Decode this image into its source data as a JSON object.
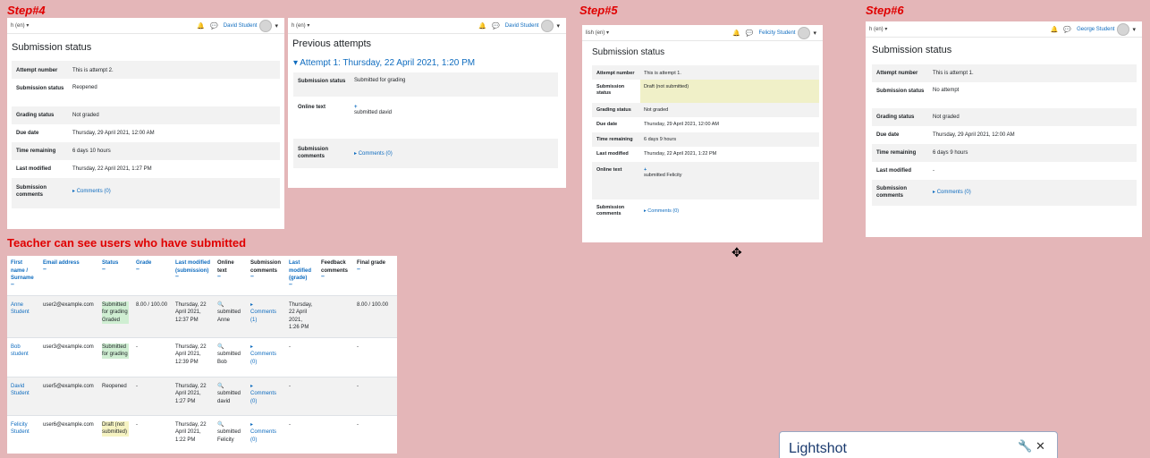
{
  "steps": {
    "s4": "Step#4",
    "s5": "Step#5",
    "s6": "Step#6"
  },
  "teacher_note": "Teacher can see users who have submitted",
  "panelA": {
    "lang": "h (en) ▾",
    "user": "David Student",
    "title": "Submission status",
    "rows": [
      {
        "k": "Attempt number",
        "v": "This is attempt 2."
      },
      {
        "k": "Submission status",
        "v": "Reopened"
      },
      {
        "k": "Grading status",
        "v": "Not graded"
      },
      {
        "k": "Due date",
        "v": "Thursday, 29 April 2021, 12:00 AM"
      },
      {
        "k": "Time remaining",
        "v": "6 days 10 hours"
      },
      {
        "k": "Last modified",
        "v": "Thursday, 22 April 2021, 1:27 PM"
      },
      {
        "k": "Submission comments",
        "v": "Comments (0)"
      }
    ]
  },
  "panelB": {
    "lang": "h (en) ▾",
    "user": "David Student",
    "title": "Previous attempts",
    "attempt": "Attempt 1: Thursday, 22 April 2021, 1:20 PM",
    "rows": [
      {
        "k": "Submission status",
        "v": "Submitted for grading"
      },
      {
        "k": "Online text",
        "v": "submitted david"
      },
      {
        "k": "Submission comments",
        "v": "Comments (0)"
      }
    ]
  },
  "panelC": {
    "lang": "lish (en) ▾",
    "user": "Felicity Student",
    "title": "Submission status",
    "rows": [
      {
        "k": "Attempt number",
        "v": "This is attempt 1."
      },
      {
        "k": "Submission status",
        "v": "Draft (not submitted)"
      },
      {
        "k": "Grading status",
        "v": "Not graded"
      },
      {
        "k": "Due date",
        "v": "Thursday, 29 April 2021, 12:00 AM"
      },
      {
        "k": "Time remaining",
        "v": "6 days 9 hours"
      },
      {
        "k": "Last modified",
        "v": "Thursday, 22 April 2021, 1:22 PM"
      },
      {
        "k": "Online text",
        "v": "submitted Felicity"
      },
      {
        "k": "Submission comments",
        "v": "Comments (0)"
      }
    ]
  },
  "panelD": {
    "lang": "h (en) ▾",
    "user": "George Student",
    "title": "Submission status",
    "rows": [
      {
        "k": "Attempt number",
        "v": "This is attempt 1."
      },
      {
        "k": "Submission status",
        "v": "No attempt"
      },
      {
        "k": "Grading status",
        "v": "Not graded"
      },
      {
        "k": "Due date",
        "v": "Thursday, 29 April 2021, 12:00 AM"
      },
      {
        "k": "Time remaining",
        "v": "6 days 9 hours"
      },
      {
        "k": "Last modified",
        "v": "-"
      },
      {
        "k": "Submission comments",
        "v": "Comments (0)"
      }
    ]
  },
  "grading": {
    "headers": [
      "First name / Surname",
      "Email address",
      "Status",
      "Grade",
      "Last modified (submission)",
      "Online text",
      "Submission comments",
      "Last modified (grade)",
      "Feedback comments",
      "Final grade"
    ],
    "rows": [
      {
        "name": "Anne Student",
        "email": "user2@example.com",
        "status": "Submitted for grading Graded",
        "grade": "8.00 / 100.00",
        "modified": "Thursday, 22 April 2021, 12:37 PM",
        "online": "submitted Anne",
        "comments": "Comments (1)",
        "gradeMod": "Thursday, 22 April 2021, 1:26 PM",
        "feedback": "",
        "final": "8.00 / 100.00"
      },
      {
        "name": "Bob student",
        "email": "user3@example.com",
        "status": "Submitted for grading",
        "grade": "-",
        "modified": "Thursday, 22 April 2021, 12:39 PM",
        "online": "submitted Bob",
        "comments": "Comments (0)",
        "gradeMod": "-",
        "feedback": "",
        "final": "-"
      },
      {
        "name": "David Student",
        "email": "user5@example.com",
        "status": "Reopened",
        "grade": "-",
        "modified": "Thursday, 22 April 2021, 1:27 PM",
        "online": "submitted david",
        "comments": "Comments (0)",
        "gradeMod": "-",
        "feedback": "",
        "final": "-"
      },
      {
        "name": "Felicity Student",
        "email": "user6@example.com",
        "status": "Draft (not submitted)",
        "grade": "-",
        "modified": "Thursday, 22 April 2021, 1:22 PM",
        "online": "submitted Felicity",
        "comments": "Comments (0)",
        "gradeMod": "-",
        "feedback": "",
        "final": "-"
      }
    ]
  },
  "lightshot": {
    "title": "Lightshot"
  },
  "colors": {
    "accent": "#0f6cbf",
    "note": "#e00000",
    "background": "#e4b6b8"
  }
}
